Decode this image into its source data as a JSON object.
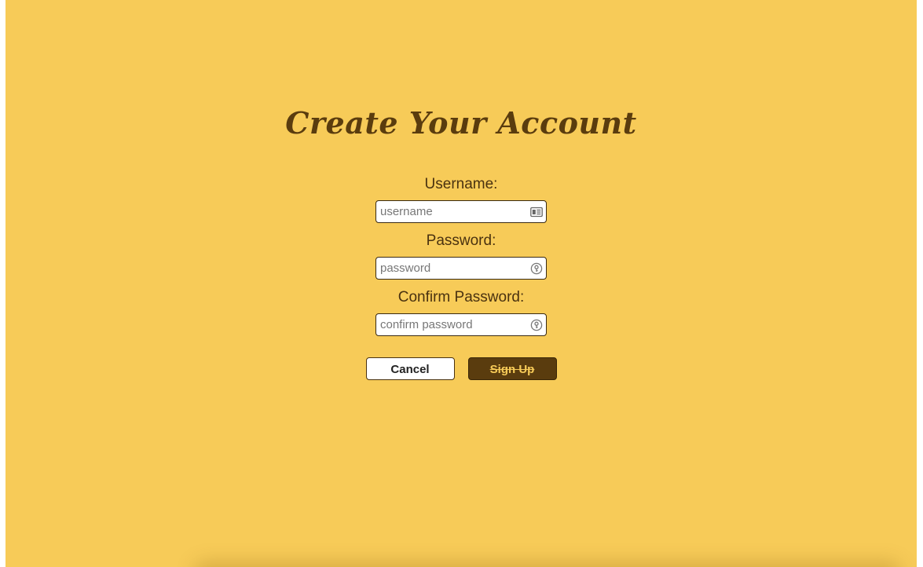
{
  "page": {
    "title": "Create Your Account",
    "background_color": "#f7cb58",
    "accent_color": "#5a3c0e"
  },
  "form": {
    "username": {
      "label": "Username:",
      "value": "",
      "placeholder": "username",
      "icon": "contact-card-icon"
    },
    "password": {
      "label": "Password:",
      "value": "",
      "placeholder": "password",
      "icon": "key-icon"
    },
    "confirm_password": {
      "label": "Confirm Password:",
      "value": "",
      "placeholder": "confirm password",
      "icon": "key-icon"
    }
  },
  "buttons": {
    "cancel_label": "Cancel",
    "signup_label": "Sign Up"
  }
}
